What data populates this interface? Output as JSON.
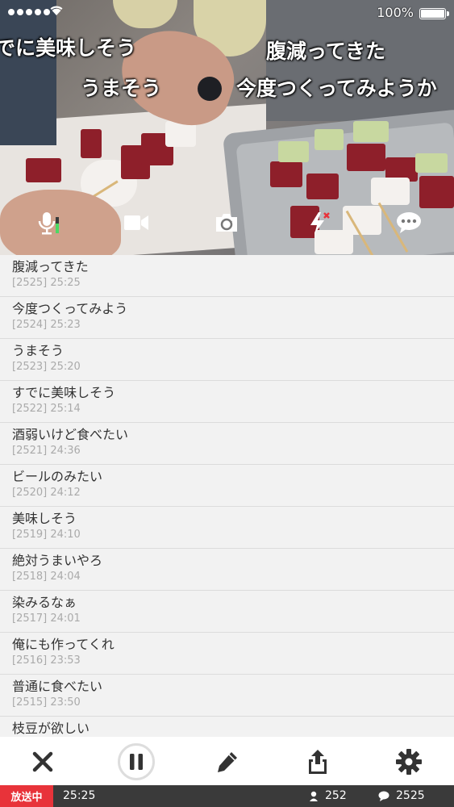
{
  "status_bar": {
    "battery_percent": "100%"
  },
  "overlay_comments": [
    {
      "text": "でに美味しそう"
    },
    {
      "text": "腹減ってきた"
    },
    {
      "text": "うまそう"
    },
    {
      "text": "今度つくってみようか"
    }
  ],
  "controls": {
    "mic_icon": "microphone-icon",
    "video_icon": "video-camera-icon",
    "camera_flip_icon": "camera-flip-icon",
    "flash_icon": "flash-off-icon",
    "comment_icon": "speech-bubble-icon"
  },
  "comments": [
    {
      "text": "腹減ってきた",
      "meta": "[2525] 25:25"
    },
    {
      "text": "今度つくってみよう",
      "meta": "[2524] 25:23"
    },
    {
      "text": "うまそう",
      "meta": "[2523] 25:20"
    },
    {
      "text": "すでに美味しそう",
      "meta": "[2522] 25:14"
    },
    {
      "text": "酒弱いけど食べたい",
      "meta": "[2521] 24:36"
    },
    {
      "text": "ビールのみたい",
      "meta": "[2520] 24:12"
    },
    {
      "text": "美味しそう",
      "meta": "[2519] 24:10"
    },
    {
      "text": "絶対うまいやろ",
      "meta": "[2518] 24:04"
    },
    {
      "text": "染みるなぁ",
      "meta": "[2517] 24:01"
    },
    {
      "text": "俺にも作ってくれ",
      "meta": "[2516] 23:53"
    },
    {
      "text": "普通に食べたい",
      "meta": "[2515] 23:50"
    },
    {
      "text": "枝豆が欲しい",
      "meta": ""
    }
  ],
  "toolbar": {
    "close_icon": "close-icon",
    "pause_icon": "pause-icon",
    "edit_icon": "pencil-icon",
    "share_icon": "share-icon",
    "settings_icon": "gear-icon"
  },
  "footer": {
    "live_label": "放送中",
    "elapsed": "25:25",
    "viewers": "252",
    "comment_count": "2525"
  },
  "colors": {
    "live_badge": "#e8333a",
    "footer_bg": "#3a3a3a",
    "list_bg": "#f2f2f2"
  }
}
